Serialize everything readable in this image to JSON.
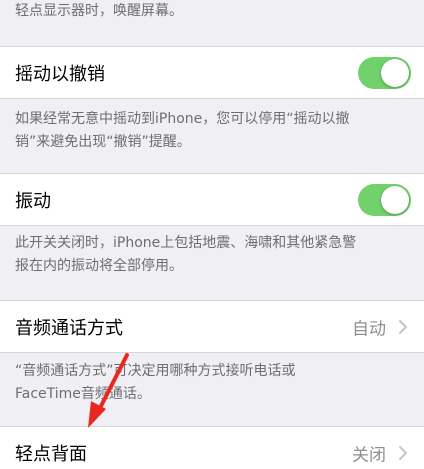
{
  "top_note": "轻点显示器时，唤醒屏幕。",
  "shake_to_undo": {
    "label": "摇动以撤销",
    "enabled": true,
    "note_line1": "如果经常无意中摇动到iPhone，您可以停用“摇动以撤",
    "note_line2": "销”来避免出现“撤销”提醒。"
  },
  "vibration": {
    "label": "振动",
    "enabled": true,
    "note_line1": "此开关关闭时，iPhone上包括地震、海啸和其他紧急警",
    "note_line2": "报在内的振动将全部停用。"
  },
  "call_audio_routing": {
    "label": "音频通话方式",
    "value": "自动",
    "note_line1": "“音频通话方式”可决定用哪种方式接听电话或",
    "note_line2": "FaceTime音频通话。"
  },
  "back_tap": {
    "label": "轻点背面",
    "value": "关闭"
  },
  "colors": {
    "toggle_on": "#71d26b",
    "arrow": "#e8281e",
    "background": "#efeff4"
  }
}
